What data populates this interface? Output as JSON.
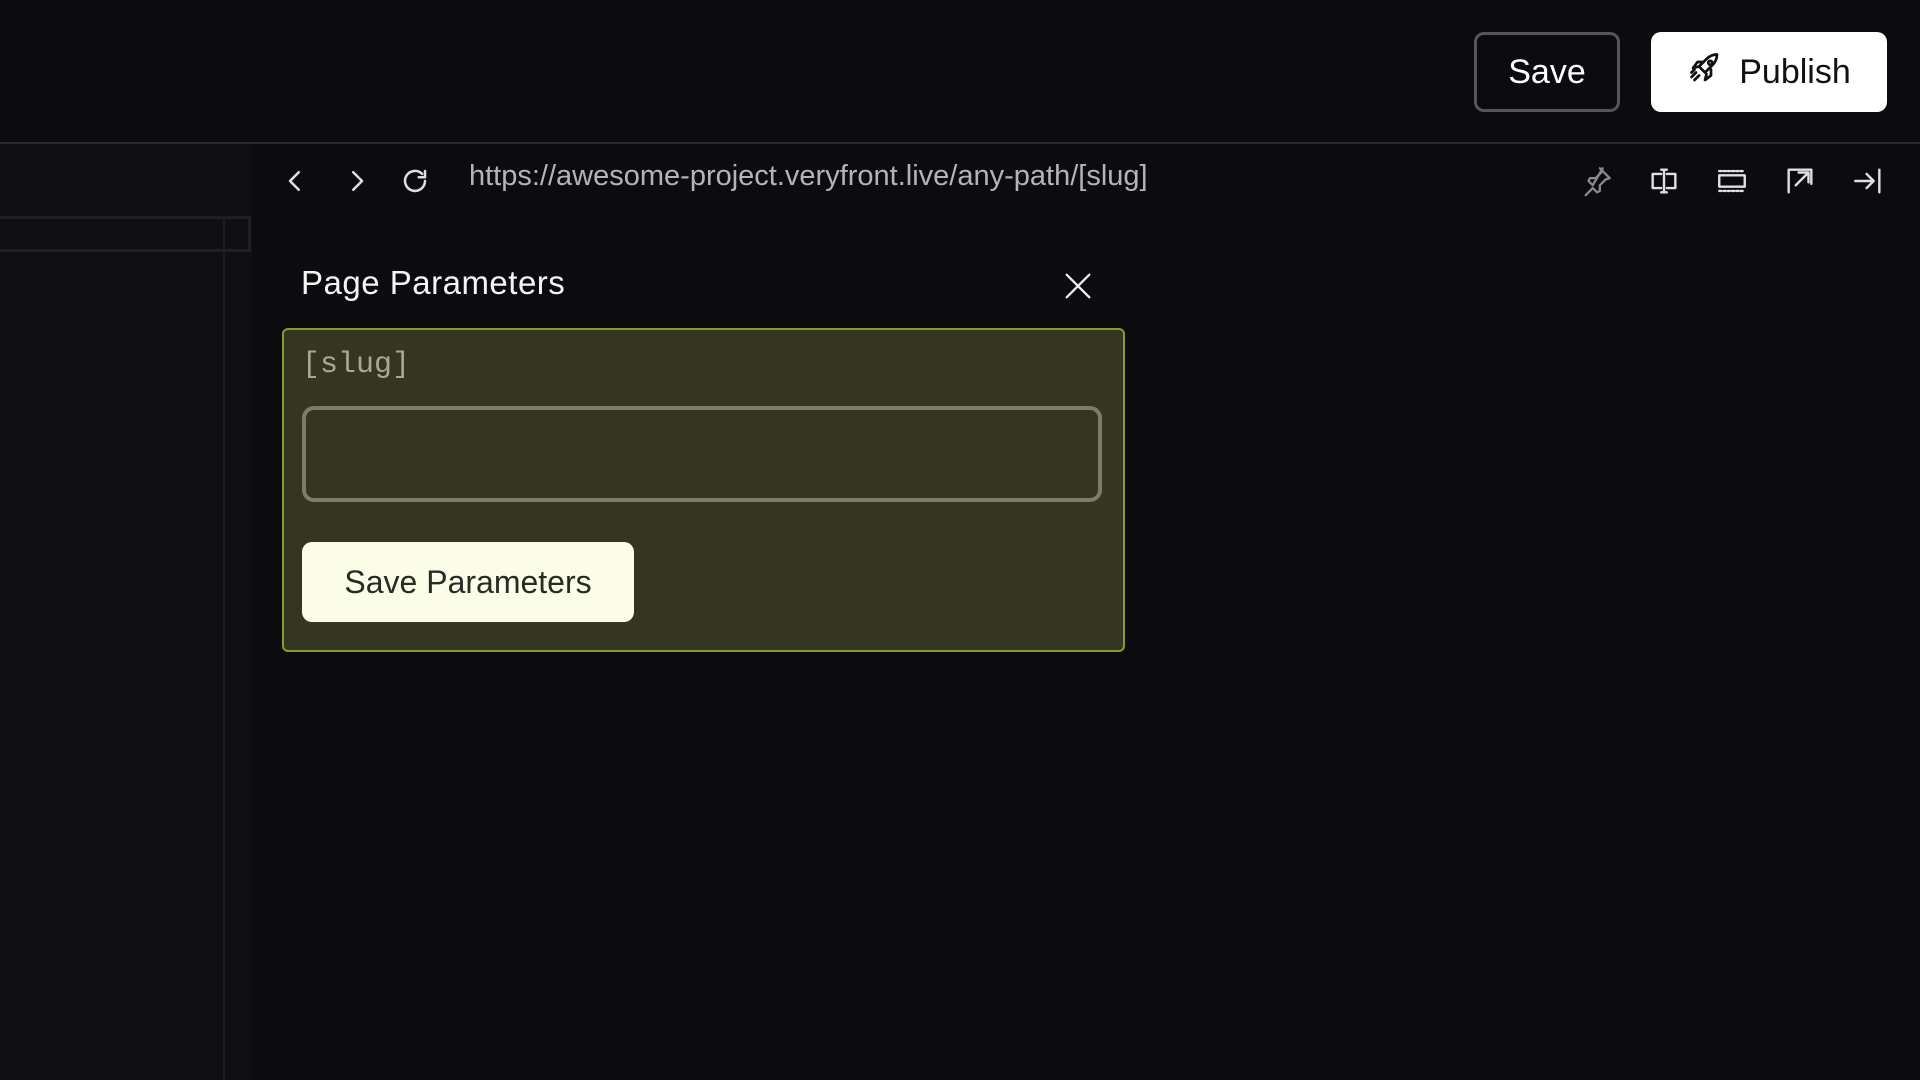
{
  "header": {
    "save_label": "Save",
    "publish_label": "Publish"
  },
  "browser": {
    "url": "https://awesome-project.veryfront.live/any-path/[slug]",
    "icons": [
      "chevron-left-icon",
      "chevron-right-icon",
      "reload-icon",
      "pin-icon",
      "text-cursor-frame-icon",
      "viewport-icon",
      "open-external-icon",
      "collapse-panel-icon"
    ]
  },
  "params_panel": {
    "title": "Page Parameters",
    "params": [
      {
        "name": "[slug]",
        "value": "",
        "placeholder": ""
      }
    ],
    "save_label": "Save Parameters"
  },
  "colors": {
    "background": "#0c0c10",
    "card_bg": "#343621",
    "card_border": "#8a9a2e",
    "primary_button": "#ffffff",
    "save_params_button": "#fbfde8"
  }
}
